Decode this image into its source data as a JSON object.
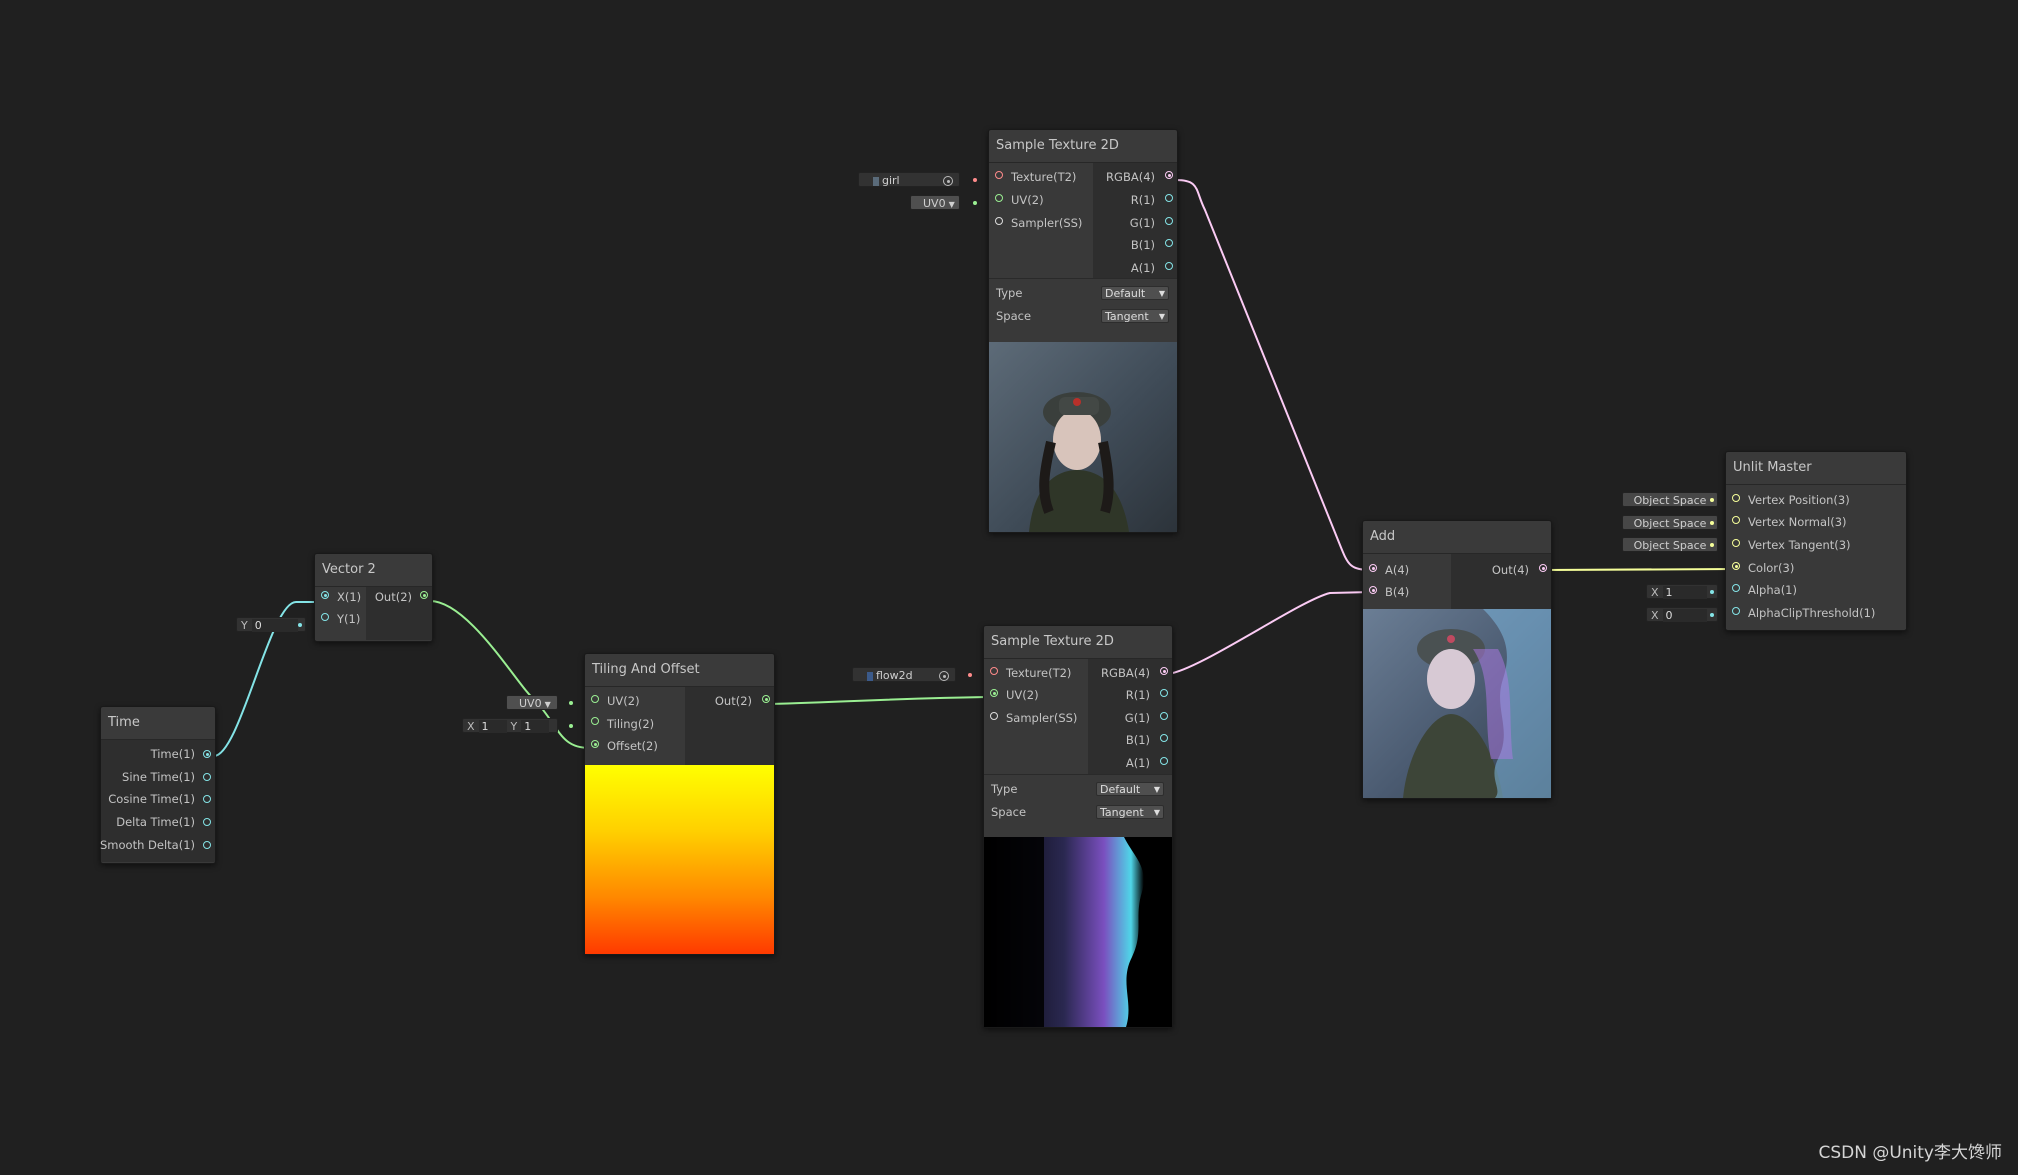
{
  "colors": {
    "background": "#202020",
    "port_float": "#84e4e7",
    "port_vector2": "#9aef92",
    "port_vector3": "#f6ff9a",
    "port_vector4": "#fbcbf4",
    "port_texture": "#ff8b8b",
    "port_sampler": "#dcdcdc"
  },
  "nodes": {
    "time": {
      "title": "Time",
      "outputs": [
        "Time(1)",
        "Sine Time(1)",
        "Cosine Time(1)",
        "Delta Time(1)",
        "Smooth Delta(1)"
      ]
    },
    "vector2": {
      "title": "Vector 2",
      "inputs": [
        "X(1)",
        "Y(1)"
      ],
      "output": "Out(2)",
      "y_field_label": "Y",
      "y_field_value": "0"
    },
    "tiling": {
      "title": "Tiling And Offset",
      "inputs": [
        "UV(2)",
        "Tiling(2)",
        "Offset(2)"
      ],
      "output": "Out(2)",
      "uv_dropdown": "UV0",
      "tiling_x_label": "X",
      "tiling_x_value": "1",
      "tiling_y_label": "Y",
      "tiling_y_value": "1"
    },
    "sample_girl": {
      "title": "Sample Texture 2D",
      "inputs": [
        "Texture(T2)",
        "UV(2)",
        "Sampler(SS)"
      ],
      "outputs": [
        "RGBA(4)",
        "R(1)",
        "G(1)",
        "B(1)",
        "A(1)"
      ],
      "texture_name": "girl",
      "uv_dropdown": "UV0",
      "type_label": "Type",
      "type_value": "Default",
      "space_label": "Space",
      "space_value": "Tangent"
    },
    "sample_flow": {
      "title": "Sample Texture 2D",
      "inputs": [
        "Texture(T2)",
        "UV(2)",
        "Sampler(SS)"
      ],
      "outputs": [
        "RGBA(4)",
        "R(1)",
        "G(1)",
        "B(1)",
        "A(1)"
      ],
      "texture_name": "flow2d",
      "type_label": "Type",
      "type_value": "Default",
      "space_label": "Space",
      "space_value": "Tangent"
    },
    "add": {
      "title": "Add",
      "inputs": [
        "A(4)",
        "B(4)"
      ],
      "output": "Out(4)"
    },
    "unlit": {
      "title": "Unlit Master",
      "inputs": [
        "Vertex Position(3)",
        "Vertex Normal(3)",
        "Vertex Tangent(3)",
        "Color(3)",
        "Alpha(1)",
        "AlphaClipThreshold(1)"
      ],
      "space_fields": [
        "Object Space",
        "Object Space",
        "Object Space"
      ],
      "alpha_label": "X",
      "alpha_value": "1",
      "clip_label": "X",
      "clip_value": "0"
    }
  },
  "watermark": "CSDN @Unity李大馋师"
}
